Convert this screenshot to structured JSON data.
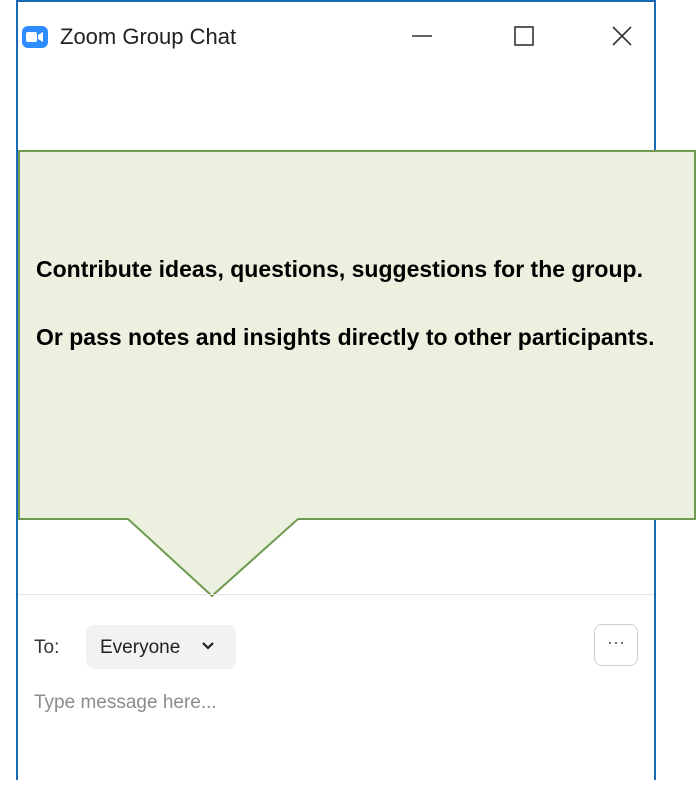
{
  "window": {
    "title": "Zoom Group Chat",
    "controls": {
      "minimize": "minimize-icon",
      "maximize": "maximize-icon",
      "close": "close-icon"
    }
  },
  "callout": {
    "line1": "Contribute ideas, questions, suggestions for the group.",
    "line2": "Or pass notes and insights directly to other participants."
  },
  "compose": {
    "to_label": "To:",
    "recipient": "Everyone",
    "more_label": "···",
    "placeholder": "Type message here..."
  },
  "colors": {
    "window_border": "#1a6ab8",
    "zoom_blue": "#2d8cff",
    "callout_fill": "#ebf1de",
    "callout_border": "#6f9a50"
  }
}
